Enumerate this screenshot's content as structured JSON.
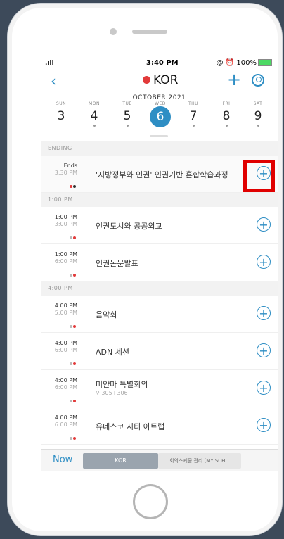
{
  "status": {
    "time": "3:40 PM",
    "battery": "100%"
  },
  "nav": {
    "title": "KOR"
  },
  "calendar": {
    "month": "OCTOBER 2021",
    "days": [
      {
        "name": "SUN",
        "date": "3"
      },
      {
        "name": "MON",
        "date": "4"
      },
      {
        "name": "TUE",
        "date": "5"
      },
      {
        "name": "WED",
        "date": "6"
      },
      {
        "name": "THU",
        "date": "7"
      },
      {
        "name": "FRI",
        "date": "8"
      },
      {
        "name": "SAT",
        "date": "9"
      }
    ]
  },
  "sections": {
    "ending": "ENDING",
    "s1": "1:00 PM",
    "s2": "4:00 PM"
  },
  "events": [
    {
      "start": "Ends",
      "end": "3:30 PM",
      "title": "'지방정부와 인권' 인권기반 혼합학습과정",
      "location": ""
    },
    {
      "start": "1:00 PM",
      "end": "3:00 PM",
      "title": "인권도시와 공공외교",
      "location": ""
    },
    {
      "start": "1:00 PM",
      "end": "6:00 PM",
      "title": "인권논문발표",
      "location": ""
    },
    {
      "start": "4:00 PM",
      "end": "5:00 PM",
      "title": "음악회",
      "location": ""
    },
    {
      "start": "4:00 PM",
      "end": "6:00 PM",
      "title": "ADN 세션",
      "location": ""
    },
    {
      "start": "4:00 PM",
      "end": "6:00 PM",
      "title": "미얀마 특별회의",
      "location": "305+306"
    },
    {
      "start": "4:00 PM",
      "end": "6:00 PM",
      "title": "유네스코 시티 아트랩",
      "location": ""
    }
  ],
  "bottom": {
    "now": "Now",
    "tab1": "KOR",
    "tab2": "회의스케줄 관리 (MY SCH..."
  },
  "colors": {
    "accent": "#2e8ec4",
    "highlight": "#e00000",
    "dot_red": "#e23a3a"
  }
}
